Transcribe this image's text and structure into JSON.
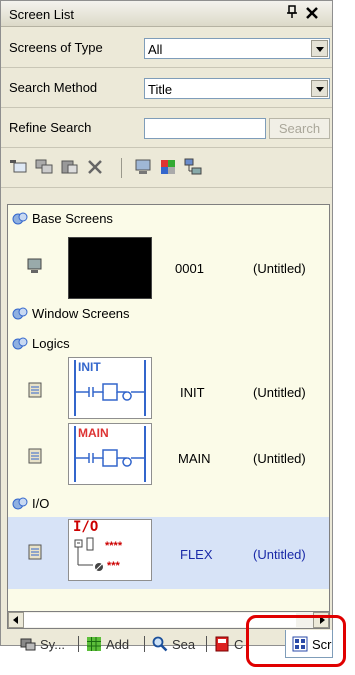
{
  "panel": {
    "title": "Screen List",
    "pin_glyph": "‑p",
    "close_glyph": "✕"
  },
  "filters": {
    "type_label": "Screens of Type",
    "type_value": "All",
    "method_label": "Search Method",
    "method_value": "Title",
    "refine_label": "Refine Search",
    "refine_value": "",
    "search_button": "Search"
  },
  "toolbar": [
    {
      "icon": "new-screen-icon"
    },
    {
      "icon": "copy-screen-icon"
    },
    {
      "icon": "paste-screen-icon"
    },
    {
      "icon": "delete-icon"
    },
    {
      "icon": "monitor-icon"
    },
    {
      "icon": "color-palette-icon"
    },
    {
      "icon": "screen-tree-icon"
    }
  ],
  "list": {
    "groups": [
      {
        "label": "Base Screens"
      },
      {
        "label": "Window Screens"
      },
      {
        "label": "Logics"
      },
      {
        "label": "I/O"
      }
    ],
    "items": [
      {
        "name": "0001",
        "title": "(Untitled)",
        "thumb_label": ""
      },
      {
        "name": "INIT",
        "title": "(Untitled)",
        "thumb_label": "INIT"
      },
      {
        "name": "MAIN",
        "title": "(Untitled)",
        "thumb_label": "MAIN"
      },
      {
        "name": "FLEX",
        "title": "(Untitled)",
        "thumb_label": "I/O",
        "stars1": "****",
        "stars2": "***"
      }
    ]
  },
  "tabs": [
    {
      "label": "Sy...",
      "icon": "system-icon"
    },
    {
      "label": "Add",
      "icon": "address-grid-icon"
    },
    {
      "label": "Sea",
      "icon": "search-icon"
    },
    {
      "label": "C",
      "icon": "red-book-icon"
    },
    {
      "label": "Scr",
      "icon": "screen-list-icon",
      "active": true
    }
  ],
  "colors": {
    "accent_highlight": "#e00000",
    "selection": "#d7e3f7",
    "list_bg": "#fbfbe8",
    "panel_bg": "#ece9d8"
  }
}
